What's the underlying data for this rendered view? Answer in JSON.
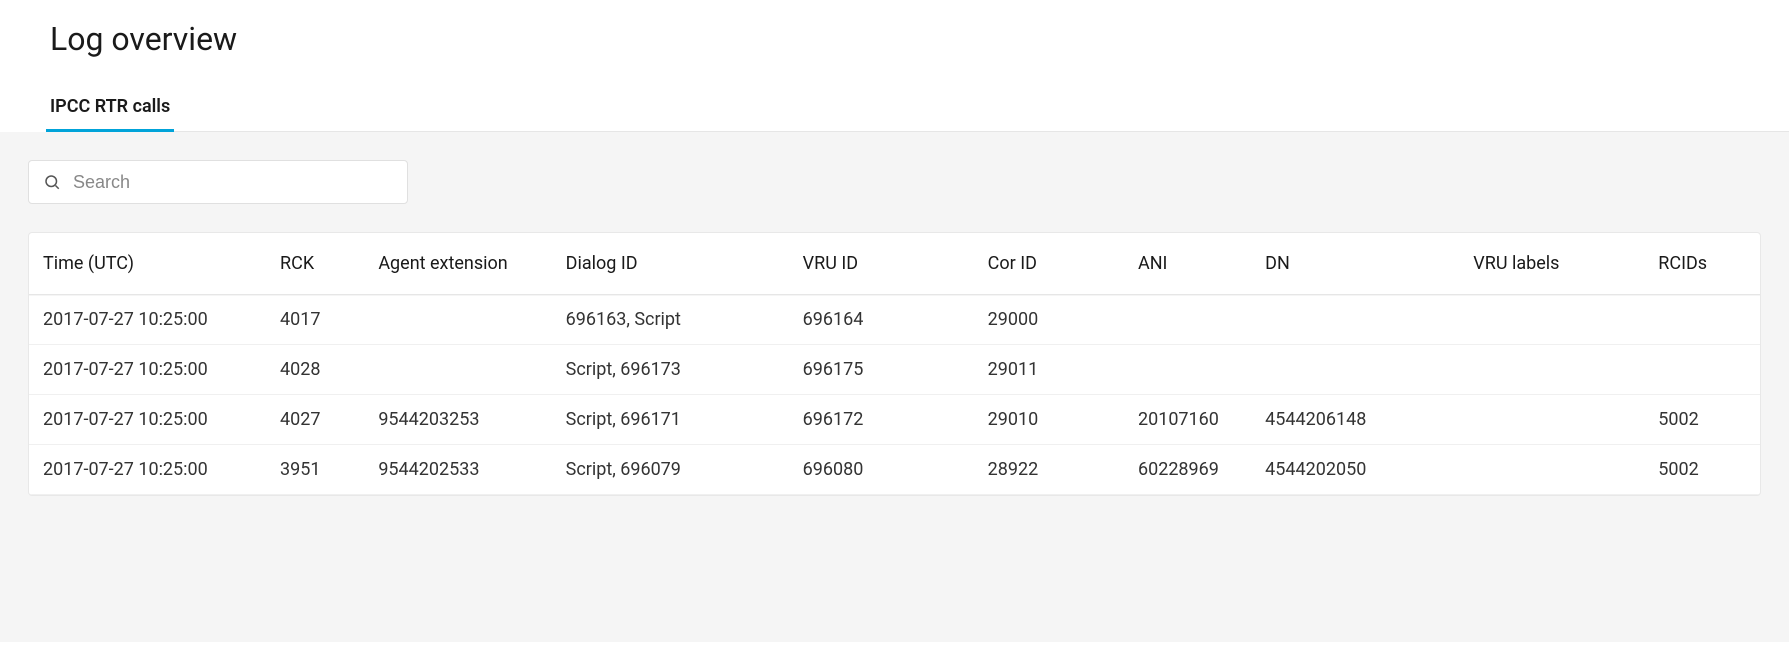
{
  "header": {
    "title": "Log overview"
  },
  "tabs": [
    {
      "label": "IPCC RTR calls",
      "active": true
    }
  ],
  "search": {
    "placeholder": "Search",
    "value": ""
  },
  "table": {
    "columns": [
      "Time (UTC)",
      "RCK",
      "Agent extension",
      "Dialog ID",
      "VRU ID",
      "Cor ID",
      "ANI",
      "DN",
      "VRU labels",
      "RCIDs"
    ],
    "rows": [
      {
        "active": false,
        "cells": [
          "2017-07-27 10:25:00",
          "4017",
          "",
          "696163, Script",
          "696164",
          "29000",
          "",
          "",
          "",
          ""
        ]
      },
      {
        "active": false,
        "cells": [
          "2017-07-27 10:25:00",
          "4028",
          "",
          "Script, 696173",
          "696175",
          "29011",
          "",
          "",
          "",
          ""
        ]
      },
      {
        "active": false,
        "cells": [
          "2017-07-27 10:25:00",
          "4027",
          "9544203253",
          "Script, 696171",
          "696172",
          "29010",
          "20107160",
          "4544206148",
          "",
          "5002"
        ]
      },
      {
        "active": true,
        "cells": [
          "2017-07-27 10:25:00",
          "3951",
          "9544202533",
          "Script, 696079",
          "696080",
          "28922",
          "60228969",
          "4544202050",
          "",
          "5002"
        ]
      }
    ]
  }
}
